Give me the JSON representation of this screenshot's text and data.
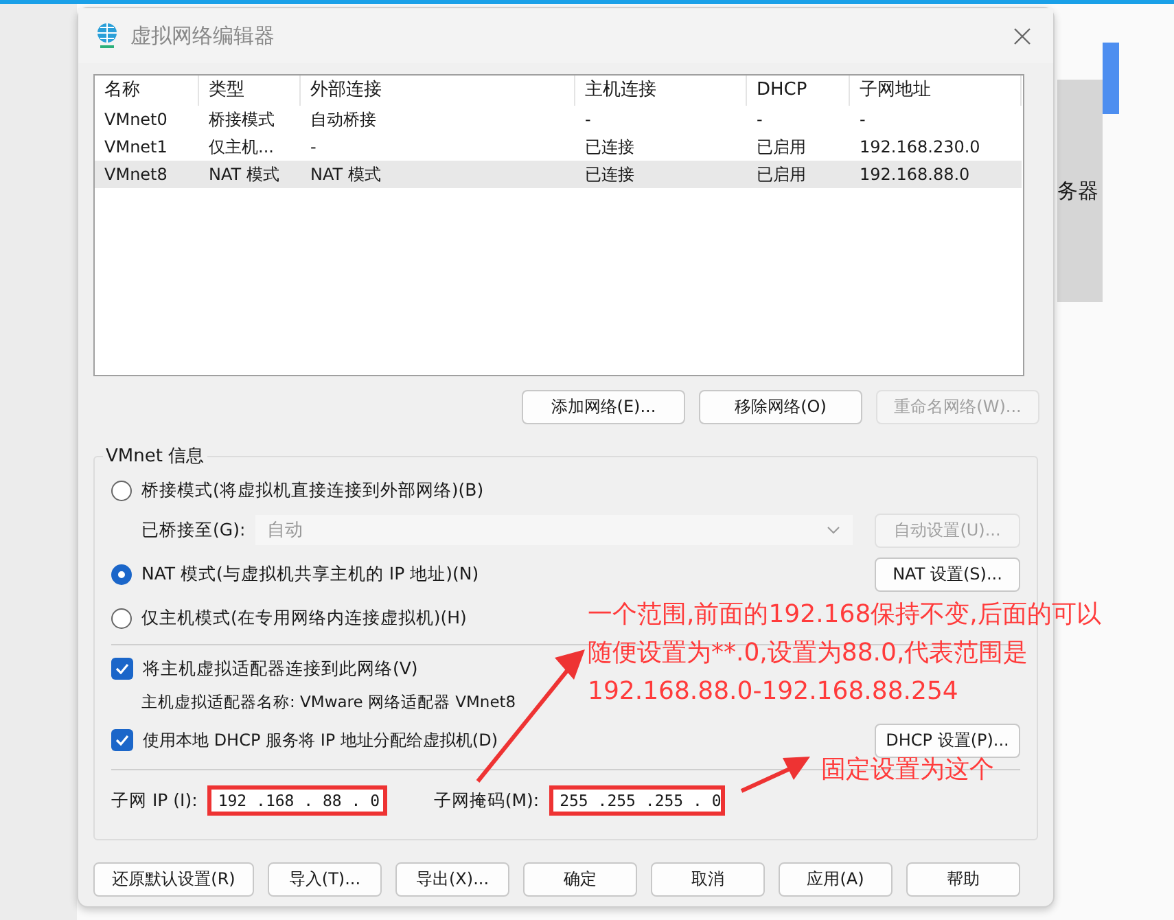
{
  "window": {
    "title": "虚拟网络编辑器"
  },
  "background_window": {
    "text": "务器"
  },
  "table": {
    "columns": [
      "名称",
      "类型",
      "外部连接",
      "主机连接",
      "DHCP",
      "子网地址"
    ],
    "rows": [
      {
        "cells": [
          "VMnet0",
          "桥接模式",
          "自动桥接",
          "-",
          "-",
          "-"
        ],
        "selected": false
      },
      {
        "cells": [
          "VMnet1",
          "仅主机...",
          "-",
          "已连接",
          "已启用",
          "192.168.230.0"
        ],
        "selected": false
      },
      {
        "cells": [
          "VMnet8",
          "NAT 模式",
          "NAT 模式",
          "已连接",
          "已启用",
          "192.168.88.0"
        ],
        "selected": true
      }
    ]
  },
  "table_buttons": [
    {
      "label": "添加网络(E)...",
      "disabled": false
    },
    {
      "label": "移除网络(O)",
      "disabled": false
    },
    {
      "label": "重命名网络(W)...",
      "disabled": true
    }
  ],
  "vmnet_info": {
    "title": "VMnet 信息",
    "modes": [
      {
        "label": "桥接模式(将虚拟机直接连接到外部网络)(B)",
        "selected": false
      },
      {
        "label": "NAT 模式(与虚拟机共享主机的 IP 地址)(N)",
        "selected": true
      },
      {
        "label": "仅主机模式(在专用网络内连接虚拟机)(H)",
        "selected": false
      }
    ],
    "bridged_to": {
      "label": "已桥接至(G):",
      "value": "自动",
      "disabled": true
    },
    "auto_button": {
      "label": "自动设置(U)...",
      "disabled": true
    },
    "nat_button": {
      "label": "NAT 设置(S)...",
      "disabled": false
    },
    "host_adapter": {
      "label": "将主机虚拟适配器连接到此网络(V)",
      "checked": true
    },
    "adapter_name": "主机虚拟适配器名称: VMware 网络适配器 VMnet8",
    "dhcp": {
      "label": "使用本地 DHCP 服务将 IP 地址分配给虚拟机(D)",
      "checked": true
    },
    "dhcp_button": {
      "label": "DHCP 设置(P)...",
      "disabled": false
    },
    "subnet_ip": {
      "label": "子网 IP (I):",
      "value": "192 .168 . 88 . 0",
      "highlighted": true
    },
    "subnet_mask": {
      "label": "子网掩码(M):",
      "value": "255 .255 .255 . 0",
      "highlighted": true
    }
  },
  "footer_buttons": [
    {
      "label": "还原默认设置(R)",
      "disabled": false
    },
    {
      "label": "导入(T)...",
      "disabled": false
    },
    {
      "label": "导出(X)...",
      "disabled": false
    },
    {
      "label": "确定",
      "disabled": false
    },
    {
      "label": "取消",
      "disabled": false
    },
    {
      "label": "应用(A)",
      "disabled": false
    },
    {
      "label": "帮助",
      "disabled": false
    }
  ],
  "annotations": [
    {
      "text": "一个范围,前面的192.168保持不变,后面的可以随便设置为**.0,设置为88.0,代表范围是192.168.88.0-192.168.88.254"
    },
    {
      "text": "固定设置为这个"
    }
  ]
}
